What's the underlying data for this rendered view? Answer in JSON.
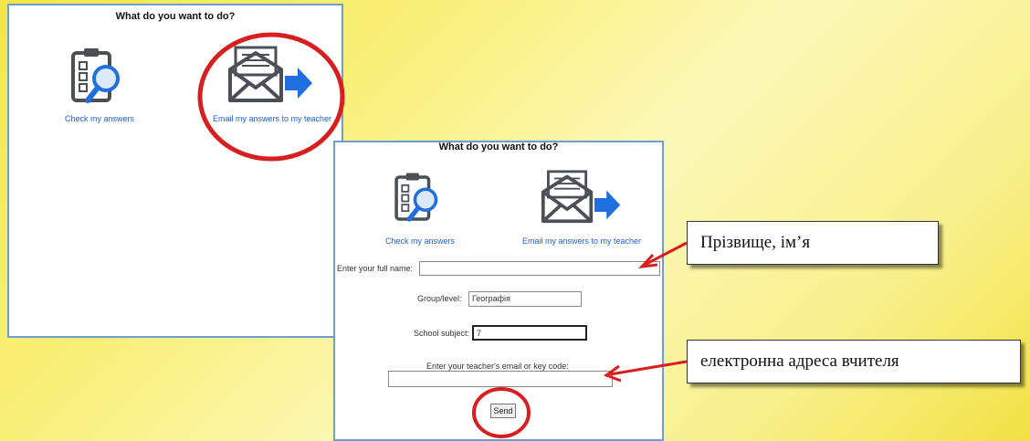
{
  "panel1": {
    "title": "What do you want to do?",
    "option_check": "Check my answers",
    "option_email": "Email my answers to my teacher"
  },
  "panel2": {
    "title": "What do you want to do?",
    "option_check": "Check my answers",
    "option_email": "Email my answers to my teacher",
    "full_name_label": "Enter your full name:",
    "full_name_value": "",
    "group_label": "Group/level:",
    "group_value": "Географія",
    "subject_label": "School subject:",
    "subject_value": "7",
    "teacher_email_label": "Enter your teacher's email or key code:",
    "teacher_email_value": "",
    "send_label": "Send"
  },
  "callouts": {
    "name": "Прізвище,  ім’я",
    "email": "електронна адреса вчителя"
  },
  "colors": {
    "annotation_red": "#d81f1f",
    "link_blue": "#1d5fd0",
    "arrow_blue": "#1f6fe0",
    "icon_gray": "#4b4f56"
  }
}
